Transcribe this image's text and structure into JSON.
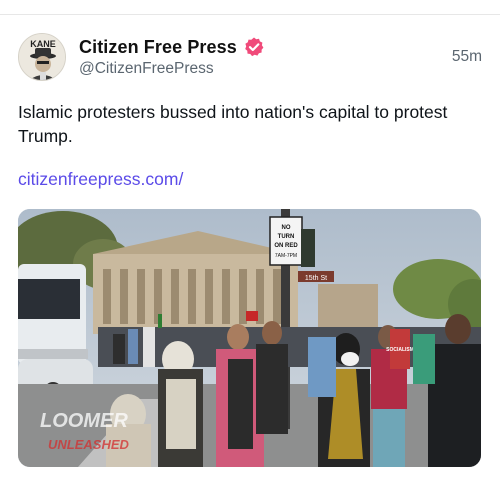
{
  "post": {
    "display_name": "Citizen Free Press",
    "handle": "@CitizenFreePress",
    "timestamp": "55m",
    "text": "Islamic protesters bussed into nation's capital to protest Trump.",
    "link_text": "citizenfreepress.com/",
    "avatar_text": "KANE",
    "media": {
      "sign_text": "NO TURN ON RED 7AM-7PM",
      "street_sign": "15th St",
      "watermark": "LOOMER UNLEASHED",
      "placard_text": "SOCIALISM"
    }
  },
  "colors": {
    "verified_badge": "#f04a7a",
    "link": "#5b4be8",
    "text": "#0f1419",
    "secondary_text": "#5b6670"
  },
  "icons": [
    "verified-badge-icon",
    "checkmark-icon"
  ]
}
